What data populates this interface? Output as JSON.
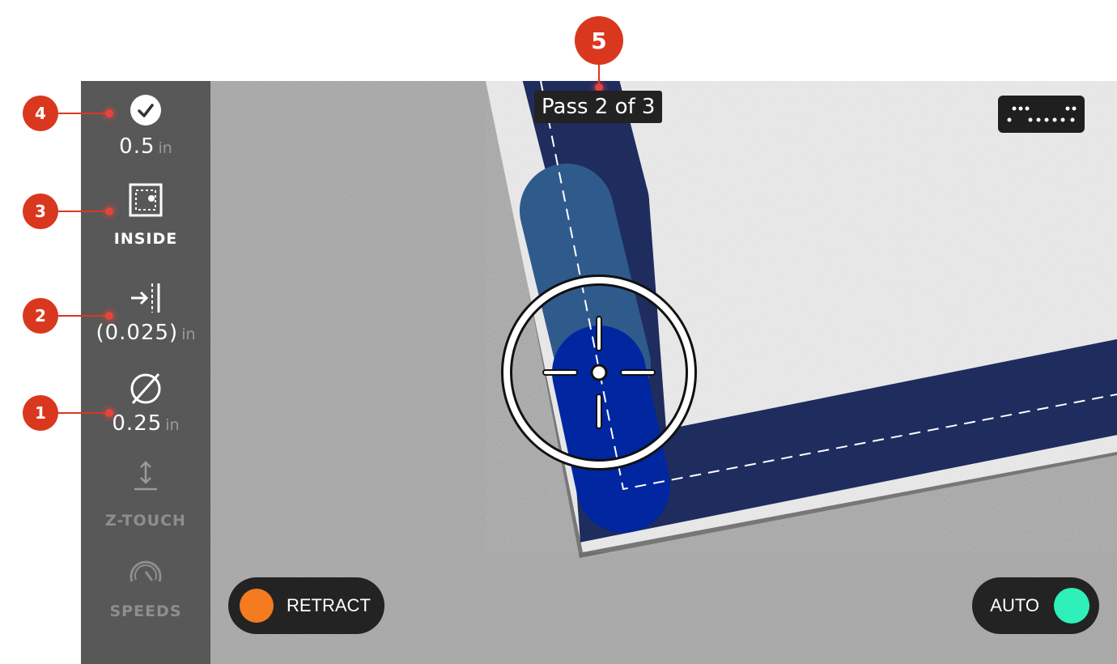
{
  "sidebar": {
    "depth": {
      "value": "0.5",
      "unit": "in",
      "icon": "check-circle-icon"
    },
    "cut_side": {
      "label": "INSIDE",
      "icon": "inside-cut-icon"
    },
    "offset": {
      "value": "(0.025)",
      "unit": "in",
      "icon": "offset-arrow-icon"
    },
    "bit_diameter": {
      "value": "0.25",
      "unit": "in",
      "icon": "diameter-icon"
    },
    "z_touch": {
      "label": "Z-TOUCH",
      "icon": "z-touch-icon"
    },
    "speeds": {
      "label": "SPEEDS",
      "icon": "speed-gauge-icon"
    }
  },
  "callouts": [
    "1",
    "2",
    "3",
    "4",
    "5"
  ],
  "pass_label": "Pass 2 of 3",
  "menu": {
    "icon": "dots-menu-icon"
  },
  "retract_button": {
    "label": "RETRACT",
    "color": "#f47b20"
  },
  "auto_toggle": {
    "label": "AUTO",
    "color": "#2ef0b8"
  },
  "colors": {
    "path_dark": "#1f2c5e",
    "path_mid": "#2f5a8c",
    "path_active": "#0026a0",
    "callout": "#d9381e"
  }
}
